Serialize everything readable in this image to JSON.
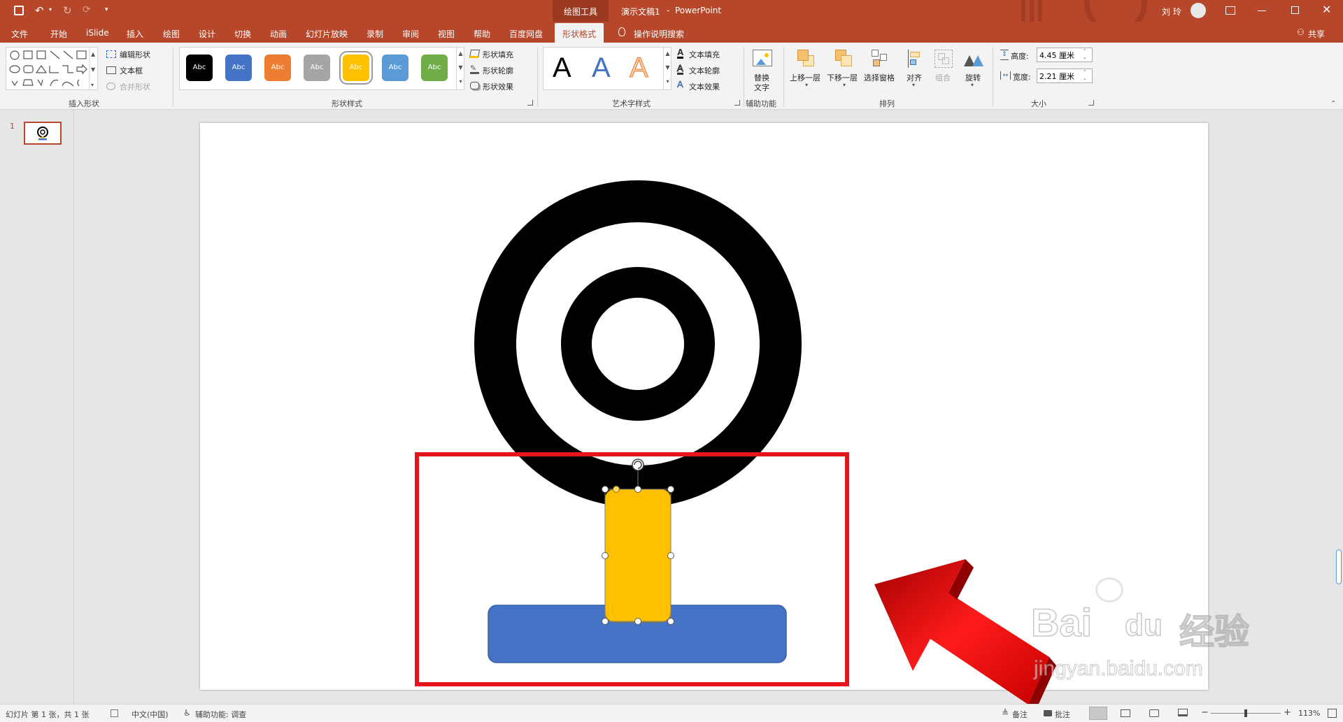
{
  "titlebar": {
    "context_tool": "绘图工具",
    "doc_title": "演示文稿1",
    "separator": "-",
    "app_name": "PowerPoint",
    "user": "刘 玲"
  },
  "tabs": [
    "文件",
    "开始",
    "iSlide",
    "插入",
    "绘图",
    "设计",
    "切换",
    "动画",
    "幻灯片放映",
    "录制",
    "审阅",
    "视图",
    "帮助",
    "百度网盘",
    "形状格式"
  ],
  "tell_me": "操作说明搜索",
  "share": "共享",
  "ribbon": {
    "insert_shapes": {
      "label": "插入形状",
      "edit_shape": "编辑形状",
      "text_box": "文本框",
      "merge_shapes": "合并形状"
    },
    "shape_styles": {
      "label": "形状样式",
      "swatch_text": "Abc",
      "swatch_colors": [
        "#000000",
        "#4472c4",
        "#ed7d31",
        "#a5a5a5",
        "#ffc000",
        "#5b9bd5",
        "#70ad47"
      ],
      "fill": "形状填充",
      "outline": "形状轮廓",
      "effects": "形状效果"
    },
    "wordart": {
      "label": "艺术字样式",
      "letter": "A",
      "text_fill": "文本填充",
      "text_outline": "文本轮廓",
      "text_effects": "文本效果"
    },
    "accessibility": {
      "label": "辅助功能",
      "alt_text_1": "替换",
      "alt_text_2": "文字"
    },
    "arrange": {
      "label": "排列",
      "bring_forward": "上移一层",
      "send_backward": "下移一层",
      "selection_pane": "选择窗格",
      "align": "对齐",
      "group": "组合",
      "rotate": "旋转"
    },
    "size": {
      "label": "大小",
      "height_label": "高度:",
      "height_value": "4.45 厘米",
      "width_label": "宽度:",
      "width_value": "2.21 厘米"
    }
  },
  "thumbnail": {
    "number": "1"
  },
  "watermark": {
    "brand": "Bai",
    "brand2": "du",
    "cn": "经验",
    "url": "jingyan.baidu.com"
  },
  "statusbar": {
    "slide_info": "幻灯片 第 1 张，共 1 张",
    "language": "中文(中国)",
    "accessibility": "辅助功能: 调查",
    "notes": "备注",
    "comments": "批注",
    "zoom": "113%"
  },
  "colors": {
    "accent": "#b7472a",
    "yellow_shape": "#ffc000",
    "blue_shape": "#4472c4",
    "highlight_box": "#e8141b",
    "arrow": "#e0161b"
  }
}
